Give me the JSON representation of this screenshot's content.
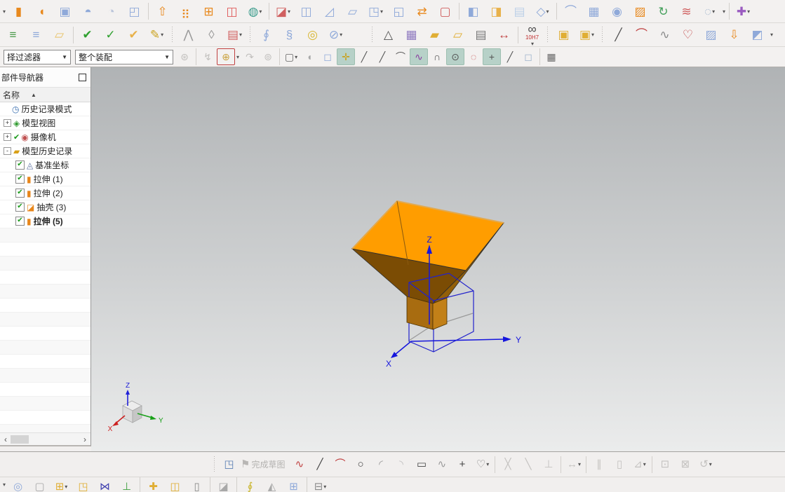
{
  "navigator": {
    "title": "部件导航器",
    "column_header": "名称",
    "sort_icon": "▲",
    "empty_rows": 15,
    "items": [
      {
        "id": "history-mode",
        "label": "历史记录模式",
        "glyph": "◷",
        "color": "#3a6fb0",
        "indent": 1
      },
      {
        "id": "model-views",
        "label": "模型视图",
        "glyph": "◈",
        "color": "#2f9a2f",
        "indent": 1,
        "expander": "+"
      },
      {
        "id": "cameras",
        "label": "摄像机",
        "glyph": "◉",
        "color": "#c05050",
        "indent": 1,
        "expander": "+",
        "precheck": true
      },
      {
        "id": "model-history",
        "label": "模型历史记录",
        "glyph": "▰",
        "color": "#d8a018",
        "indent": 1,
        "expander": "-"
      },
      {
        "id": "datum-csys",
        "label": "基准坐标",
        "glyph": "◬",
        "color": "#5a6fa0",
        "indent": 2,
        "checkbox": true
      },
      {
        "id": "extrude-1",
        "label": "拉伸 (1)",
        "glyph": "▮",
        "color": "#e8861a",
        "indent": 2,
        "checkbox": true
      },
      {
        "id": "extrude-2",
        "label": "拉伸 (2)",
        "glyph": "▮",
        "color": "#e8861a",
        "indent": 2,
        "checkbox": true
      },
      {
        "id": "shell-3",
        "label": "抽壳 (3)",
        "glyph": "◪",
        "color": "#e8861a",
        "indent": 2,
        "checkbox": true
      },
      {
        "id": "extrude-5",
        "label": "拉伸 (5)",
        "glyph": "▮",
        "color": "#e8861a",
        "indent": 2,
        "checkbox": true,
        "bold": true
      }
    ]
  },
  "toolbars": {
    "row1": [
      {
        "caret": true
      },
      {
        "n": "revolve",
        "g": "▮",
        "c": "#e8891e"
      },
      {
        "n": "revolve-half",
        "g": "◖",
        "c": "#e8891e"
      },
      {
        "n": "hole",
        "g": "▣",
        "c": "#8fa9d9"
      },
      {
        "n": "boss",
        "g": "◓",
        "c": "#8fa9d9"
      },
      {
        "n": "rib",
        "g": "◔",
        "c": "#b9c4da"
      },
      {
        "n": "pocket",
        "g": "◰",
        "c": "#8fa9d9"
      },
      {
        "sep": true
      },
      {
        "n": "extrude",
        "g": "⇧",
        "c": "#e8891e"
      },
      {
        "n": "pattern-feature",
        "g": "⣶",
        "c": "#e8891e"
      },
      {
        "n": "pattern-geometry",
        "g": "⊞",
        "c": "#e8891e"
      },
      {
        "n": "mirror-feature",
        "g": "◫",
        "c": "#e05a5a"
      },
      {
        "n": "unite",
        "g": "◍",
        "c": "#3f9e8e",
        "k": true
      },
      {
        "sep": true
      },
      {
        "n": "trim-body",
        "g": "◪",
        "c": "#d06060",
        "k": true
      },
      {
        "n": "split-body",
        "g": "◫",
        "c": "#8fa9d9"
      },
      {
        "n": "sheet-metal-bend",
        "g": "◿",
        "c": "#8fa9d9"
      },
      {
        "n": "flatten",
        "g": "▱",
        "c": "#8fa9d9"
      },
      {
        "n": "emboss-body",
        "g": "◳",
        "c": "#8fa9d9",
        "k": true
      },
      {
        "n": "cavity",
        "g": "◱",
        "c": "#8fa9d9"
      },
      {
        "n": "replace-face",
        "g": "⇄",
        "c": "#e8891e"
      },
      {
        "n": "offset-face",
        "g": "▢",
        "c": "#d06060"
      },
      {
        "sep": true
      },
      {
        "n": "shell",
        "g": "◧",
        "c": "#8fa9d9"
      },
      {
        "n": "thicken",
        "g": "◨",
        "c": "#e8b14a"
      },
      {
        "n": "sheet-body",
        "g": "▤",
        "c": "#bcd0e8"
      },
      {
        "n": "convert-wireframe",
        "g": "◇",
        "c": "#8fa9d9",
        "k": true
      },
      {
        "sep": true
      },
      {
        "n": "ruled-surface",
        "g": "⌒",
        "c": "#8fa9d9"
      },
      {
        "n": "through-curves",
        "g": "▦",
        "c": "#8fa9d9"
      },
      {
        "n": "bounded-plane",
        "g": "◉",
        "c": "#8fa9d9"
      },
      {
        "n": "swept-surface",
        "g": "▨",
        "c": "#e8891e"
      },
      {
        "n": "curve-mesh",
        "g": "↻",
        "c": "#45a05c"
      },
      {
        "n": "section-surface",
        "g": "≋",
        "c": "#d06060"
      },
      {
        "n": "n-sided-surface",
        "g": "◌",
        "c": "#9fb4cc",
        "k": true
      },
      {
        "caret": true
      },
      {
        "sep": true
      },
      {
        "n": "move-object",
        "g": "✚",
        "c": "#9a5bc0",
        "k": true
      }
    ],
    "row2": [
      {
        "n": "view-layers",
        "g": "≡",
        "c": "#4a9a4a"
      },
      {
        "n": "layer-settings",
        "g": "≡",
        "c": "#8fa9d9"
      },
      {
        "n": "tag-note",
        "g": "▱",
        "c": "#e8c268"
      },
      {
        "sep": true
      },
      {
        "n": "examine-geometry",
        "g": "✔",
        "c": "#2fa02f"
      },
      {
        "n": "heal-geometry",
        "g": "✓",
        "c": "#2fa02f"
      },
      {
        "n": "examine-body",
        "g": "✔",
        "c": "#e8b14a"
      },
      {
        "n": "rename-objects",
        "g": "✎",
        "c": "#caa21e",
        "k": true
      },
      {
        "grip": true
      },
      {
        "n": "simplify-body",
        "g": "⋀",
        "c": "#9a9a9a"
      },
      {
        "n": "wrap-geometry",
        "g": "◊",
        "c": "#9a9a9a"
      },
      {
        "n": "edit-sequence",
        "g": "▤",
        "c": "#d06060",
        "k": true
      },
      {
        "grip": true
      },
      {
        "n": "coil",
        "g": "∮",
        "c": "#8fa9d9"
      },
      {
        "n": "spring",
        "g": "§",
        "c": "#8fa9d9"
      },
      {
        "n": "washer",
        "g": "◎",
        "c": "#d8b630"
      },
      {
        "n": "spring-tools",
        "g": "⊘",
        "c": "#8fa9d9",
        "k": true
      },
      {
        "gap": 30
      },
      {
        "grip": true
      },
      {
        "n": "draft-analysis",
        "g": "△",
        "c": "#555555"
      },
      {
        "n": "deviation-table",
        "g": "▦",
        "c": "#8f7ac0"
      },
      {
        "n": "point-folder",
        "g": "▰",
        "c": "#e0ae34"
      },
      {
        "n": "group-folder",
        "g": "▱",
        "c": "#e0ae34"
      },
      {
        "n": "information-note",
        "g": "▤",
        "c": "#777777"
      },
      {
        "n": "measure-distance",
        "g": "↔",
        "c": "#c04040"
      },
      {
        "sep": true
      },
      {
        "n": "fit-reference",
        "g": "∞",
        "c": "#444444",
        "sub": "10H7",
        "k": true
      },
      {
        "grip": true
      },
      {
        "n": "lock-feature",
        "g": "▣",
        "c": "#e0ae34"
      },
      {
        "n": "lock-body",
        "g": "▣",
        "c": "#e0ae34",
        "k": true
      },
      {
        "grip": true
      },
      {
        "n": "line-curve",
        "g": "╱",
        "c": "#555555"
      },
      {
        "n": "arc-curve",
        "g": "⌒",
        "c": "#c04040"
      },
      {
        "n": "spline-polygon",
        "g": "∿",
        "c": "#8a8a8a"
      },
      {
        "n": "artistic-spline",
        "g": "♡",
        "c": "#c04040"
      },
      {
        "n": "surface-curve",
        "g": "▨",
        "c": "#8fa9d9"
      },
      {
        "n": "project-curve",
        "g": "⇩",
        "c": "#e8891e"
      },
      {
        "n": "intersection-curve",
        "g": "◩",
        "c": "#8fa9d9"
      },
      {
        "caret": true
      }
    ],
    "row3": [
      {
        "combo": true,
        "n": "selection-filter-combo",
        "v": "择过滤器",
        "w": 96
      },
      {
        "combo": true,
        "n": "assembly-scope-combo",
        "v": "整个装配",
        "w": 140
      },
      {
        "n": "snap-options",
        "g": "⊛",
        "c": "#c2c0be",
        "d": true
      },
      {
        "sep": true
      },
      {
        "n": "deselect",
        "g": "↯",
        "c": "#c2c0be",
        "d": true
      },
      {
        "n": "filter-scope",
        "g": "⊕",
        "c": "#caa23e",
        "f": true
      },
      {
        "caret": true
      },
      {
        "n": "restore-selection",
        "g": "↷",
        "c": "#c2c0be",
        "d": true
      },
      {
        "n": "selection-history",
        "g": "⊚",
        "c": "#c2c0be",
        "d": true
      },
      {
        "sep": true
      },
      {
        "n": "marquee-style",
        "g": "▢",
        "c": "#666666",
        "k": true
      },
      {
        "n": "shaded-tool",
        "g": "◖",
        "c": "#a8a8a8"
      },
      {
        "n": "snap-cube",
        "g": "◻",
        "c": "#8fa9d9"
      },
      {
        "n": "snap-point",
        "g": "✛",
        "c": "#c8a21e",
        "a": true
      },
      {
        "n": "snap-endpoint",
        "g": "╱",
        "c": "#555555"
      },
      {
        "n": "snap-midpoint",
        "g": "╱",
        "c": "#555555"
      },
      {
        "n": "snap-control-point",
        "g": "⌒",
        "c": "#555555"
      },
      {
        "n": "snap-pole",
        "g": "∿",
        "c": "#8a3fa0",
        "a": true
      },
      {
        "n": "snap-quadrant",
        "g": "∩",
        "c": "#555555"
      },
      {
        "n": "snap-arc-center",
        "g": "⊙",
        "c": "#555555",
        "a": true
      },
      {
        "n": "snap-existing-point",
        "g": "◌",
        "c": "#c04040"
      },
      {
        "n": "snap-intersection",
        "g": "+",
        "c": "#555555",
        "a": true
      },
      {
        "n": "snap-point-on-curve",
        "g": "╱",
        "c": "#555555"
      },
      {
        "n": "snap-point-on-face",
        "g": "◻",
        "c": "#9fb4cc"
      },
      {
        "sep": true
      },
      {
        "n": "grid-display",
        "g": "▦",
        "c": "#666666"
      }
    ],
    "sketch": [
      {
        "grip": true
      },
      {
        "n": "sketch-task-environment",
        "g": "◳",
        "c": "#5a7fb4"
      },
      {
        "n": "finish-sketch",
        "g": "⚑",
        "c": "#b8b6b4",
        "lab": "完成草图",
        "d": true
      },
      {
        "n": "profile",
        "g": "∿",
        "c": "#c04040"
      },
      {
        "n": "sketch-line",
        "g": "╱",
        "c": "#444444"
      },
      {
        "n": "sketch-arc",
        "g": "⌒",
        "c": "#c04040"
      },
      {
        "n": "sketch-circle",
        "g": "○",
        "c": "#444444"
      },
      {
        "n": "sketch-fillet",
        "g": "◜",
        "c": "#9a9a9a"
      },
      {
        "n": "sketch-chamfer",
        "g": "◝",
        "c": "#c0c0c0"
      },
      {
        "n": "sketch-rectangle",
        "g": "▭",
        "c": "#444444"
      },
      {
        "n": "studio-spline",
        "g": "∿",
        "c": "#9a9a9a"
      },
      {
        "n": "sketch-point",
        "g": "+",
        "c": "#444444"
      },
      {
        "n": "offset-curve",
        "g": "♡",
        "c": "#888888",
        "k": true
      },
      {
        "sep": true
      },
      {
        "n": "quick-trim",
        "g": "╳",
        "c": "#c4c2c0",
        "d": true
      },
      {
        "n": "quick-extend",
        "g": "╲",
        "c": "#c4c2c0",
        "d": true
      },
      {
        "n": "make-corner",
        "g": "⊥",
        "c": "#c4c2c0",
        "d": true
      },
      {
        "sep": true
      },
      {
        "n": "rapid-dimension",
        "g": "↔",
        "c": "#c4c2c0",
        "d": true,
        "k": true
      },
      {
        "sep": true
      },
      {
        "n": "geometric-constraints",
        "g": "∥",
        "c": "#c4c2c0",
        "d": true
      },
      {
        "n": "make-symmetric",
        "g": "▯",
        "c": "#c4c2c0",
        "d": true
      },
      {
        "n": "display-sketch-constraints",
        "g": "⊿",
        "c": "#c4c2c0",
        "d": true,
        "k": true
      },
      {
        "sep": true
      },
      {
        "n": "convert-to-reference",
        "g": "⊡",
        "c": "#c4c2c0",
        "d": true
      },
      {
        "n": "alternate-solution",
        "g": "⊠",
        "c": "#c4c2c0",
        "d": true
      },
      {
        "n": "sketch-relations",
        "g": "↺",
        "c": "#c4c2c0",
        "d": true,
        "k": true
      }
    ],
    "bottom": [
      {
        "caret": true
      },
      {
        "n": "find-component",
        "g": "◎",
        "c": "#8fa9d9"
      },
      {
        "n": "product-outline",
        "g": "▢",
        "c": "#a8a8a8"
      },
      {
        "n": "add-component",
        "g": "⊞",
        "c": "#e0ae34",
        "k": true
      },
      {
        "n": "create-new-component",
        "g": "◳",
        "c": "#e0ae34"
      },
      {
        "n": "mirror-assembly",
        "g": "⋈",
        "c": "#4444b0"
      },
      {
        "n": "suppress-component",
        "g": "⊥",
        "c": "#3fa03f"
      },
      {
        "sep": true
      },
      {
        "n": "move-component",
        "g": "✚",
        "c": "#e0ae34"
      },
      {
        "n": "assembly-constraints",
        "g": "◫",
        "c": "#e0ae34"
      },
      {
        "n": "show-degrees-of-freedom",
        "g": "▯",
        "c": "#8a8a8a"
      },
      {
        "sep": true
      },
      {
        "n": "assembly-cut",
        "g": "◪",
        "c": "#a8a8a8"
      },
      {
        "sep": true
      },
      {
        "n": "wave-geometry-linker",
        "g": "∮",
        "c": "#c8b428"
      },
      {
        "n": "interference-check",
        "g": "◭",
        "c": "#a8a8a8"
      },
      {
        "n": "exploded-view",
        "g": "⊞",
        "c": "#8fa9d9"
      },
      {
        "sep": true
      },
      {
        "n": "pattern-component",
        "g": "⊟",
        "c": "#8a8a8a",
        "k": true
      }
    ]
  },
  "viewport": {
    "axes": {
      "x": "X",
      "y": "Y",
      "z": "Z"
    },
    "triad": {
      "x": "X",
      "y": "Y",
      "z": "Z"
    }
  },
  "scrollbar": {
    "left": "‹",
    "right": "›"
  },
  "colors": {
    "toolbar_bg": "#f3f1f0",
    "viewport_top": "#b0b3b5",
    "viewport_bottom": "#ebecec",
    "model_top_face": "#ff9d00",
    "model_left_face": "#7b4c04",
    "model_right_face": "#935f08",
    "stem_left_face": "#a86c10",
    "stem_right_face": "#c28018",
    "axis_blue": "#1515dd",
    "wireframe_blue": "#2222cc",
    "triad_x_red": "#cc2020",
    "triad_y_green": "#18a018",
    "triad_z_blue": "#2020d8",
    "snap_active_bg": "#b7d1c8"
  }
}
